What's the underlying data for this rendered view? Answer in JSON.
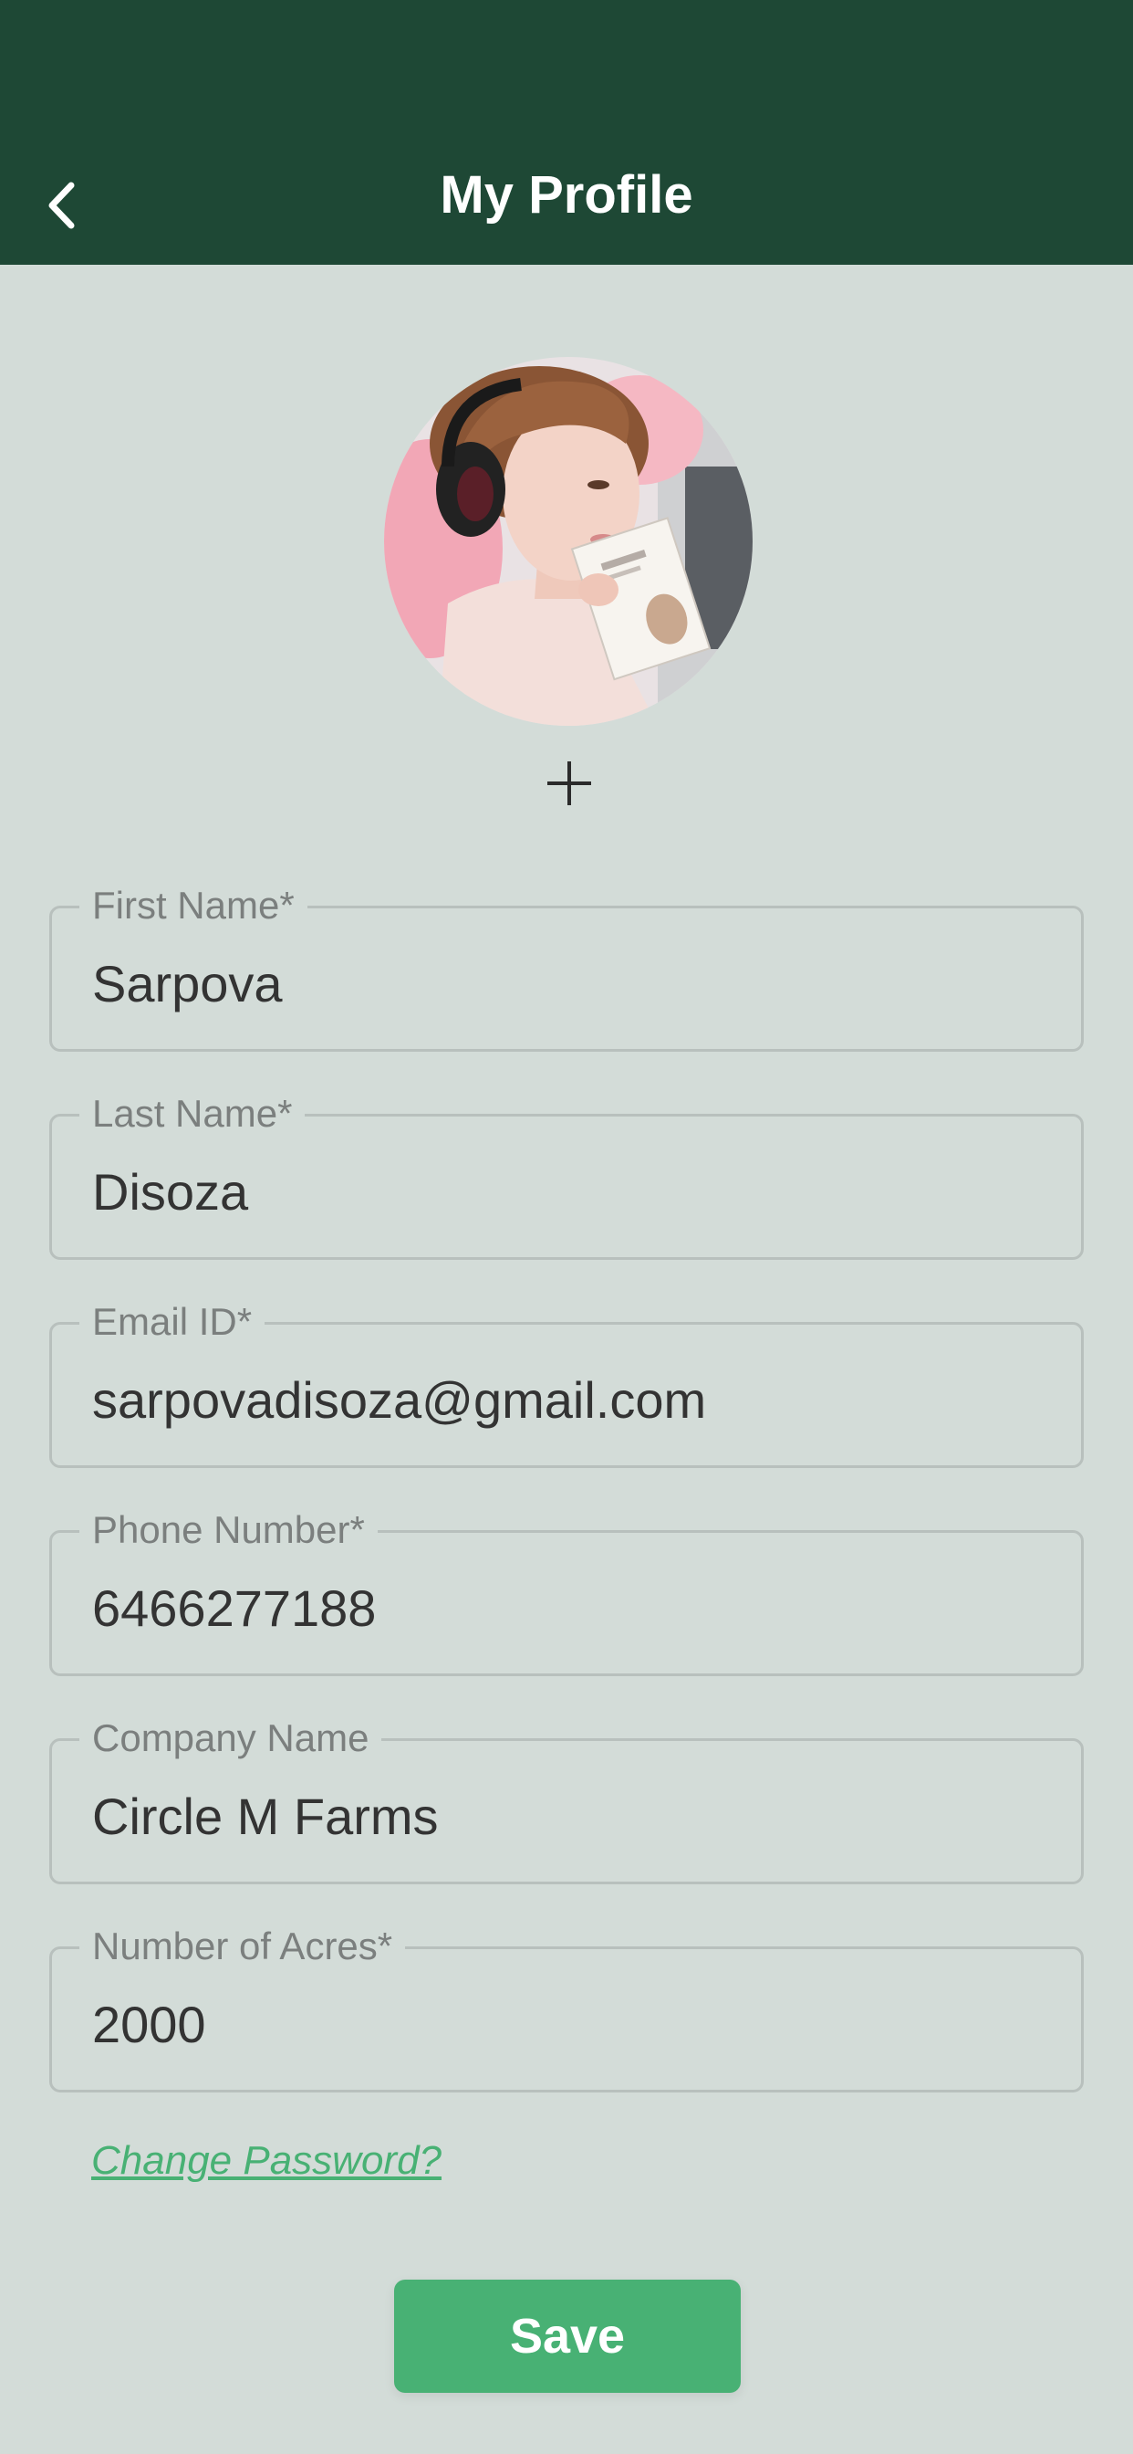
{
  "header": {
    "title": "My Profile",
    "back_icon": "chevron-left-icon",
    "background": "#1e4835"
  },
  "avatar": {
    "add_icon": "plus-icon"
  },
  "fields": [
    {
      "label": "First Name*",
      "value": "Sarpova"
    },
    {
      "label": "Last Name*",
      "value": "Disoza"
    },
    {
      "label": "Email ID*",
      "value": "sarpovadisoza@gmail.com"
    },
    {
      "label": "Phone Number*",
      "value": "6466277188"
    },
    {
      "label": "Company Name",
      "value": "Circle M Farms"
    },
    {
      "label": "Number of Acres*",
      "value": "2000"
    }
  ],
  "links": {
    "change_password": "Change Password?"
  },
  "actions": {
    "save_label": "Save"
  },
  "colors": {
    "page_background": "#d3dcd8",
    "accent": "#48b174",
    "field_border": "#b8c0bd"
  }
}
